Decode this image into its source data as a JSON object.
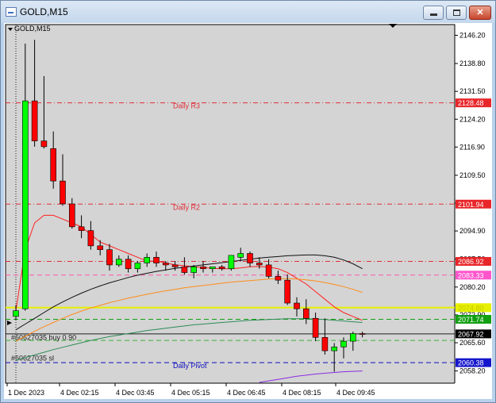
{
  "window": {
    "title": "GOLD,M15",
    "minimize_glyph": "minimize-icon",
    "maximize_glyph": "maximize-icon",
    "close_glyph": "✕"
  },
  "chart": {
    "symbol_label": "GOLD,M15",
    "colors": {
      "plot_bg": "#d4d4d4",
      "grid": "#b8b8b8",
      "bull": "#00ff00",
      "bear": "#ff0000",
      "wick": "#000000"
    }
  },
  "chart_data": {
    "type": "candlestick",
    "y_ticks": [
      "2146.20",
      "2138.80",
      "2131.50",
      "2124.20",
      "2116.90",
      "2109.50",
      "2102.20",
      "2094.90",
      "2087.50",
      "2080.20",
      "2072.90",
      "2065.60",
      "2058.20"
    ],
    "x_ticks": [
      "1 Dec 2023",
      "4 Dec 02:15",
      "4 Dec 03:45",
      "4 Dec 05:15",
      "4 Dec 06:45",
      "4 Dec 08:15",
      "4 Dec 09:45"
    ],
    "ylim": [
      2055.0,
      2149.0
    ],
    "candles": [
      [
        2072.5,
        2075.5,
        2071.5,
        2074.0
      ],
      [
        2074.5,
        2144.0,
        2074.0,
        2129.0
      ],
      [
        2129.0,
        2145.0,
        2117.0,
        2118.5
      ],
      [
        2118.5,
        2135.5,
        2116.5,
        2117.0
      ],
      [
        2116.5,
        2121.0,
        2106.0,
        2108.0
      ],
      [
        2108.0,
        2115.0,
        2101.5,
        2102.0
      ],
      [
        2102.0,
        2103.5,
        2095.5,
        2096.0
      ],
      [
        2096.0,
        2099.0,
        2093.0,
        2095.0
      ],
      [
        2095.0,
        2097.5,
        2090.0,
        2091.0
      ],
      [
        2091.0,
        2092.5,
        2088.5,
        2090.0
      ],
      [
        2090.0,
        2091.5,
        2084.5,
        2086.0
      ],
      [
        2086.0,
        2088.5,
        2085.5,
        2087.5
      ],
      [
        2087.5,
        2088.5,
        2084.0,
        2085.0
      ],
      [
        2085.0,
        2087.0,
        2084.0,
        2086.5
      ],
      [
        2086.5,
        2089.0,
        2085.5,
        2088.0
      ],
      [
        2088.0,
        2089.5,
        2085.5,
        2086.5
      ],
      [
        2086.5,
        2087.0,
        2084.5,
        2086.0
      ],
      [
        2086.0,
        2087.0,
        2084.5,
        2085.5
      ],
      [
        2085.5,
        2088.0,
        2083.5,
        2084.0
      ],
      [
        2084.0,
        2086.0,
        2082.5,
        2085.5
      ],
      [
        2085.5,
        2087.0,
        2084.0,
        2085.0
      ],
      [
        2085.0,
        2085.5,
        2084.0,
        2085.5
      ],
      [
        2085.5,
        2086.0,
        2084.5,
        2085.0
      ],
      [
        2085.0,
        2088.5,
        2084.5,
        2088.5
      ],
      [
        2088.0,
        2090.5,
        2087.0,
        2089.0
      ],
      [
        2089.0,
        2089.5,
        2085.5,
        2086.5
      ],
      [
        2086.5,
        2088.0,
        2085.0,
        2086.0
      ],
      [
        2086.0,
        2087.5,
        2082.5,
        2083.0
      ],
      [
        2083.0,
        2084.5,
        2081.0,
        2082.0
      ],
      [
        2082.0,
        2083.5,
        2075.5,
        2076.0
      ],
      [
        2076.0,
        2077.5,
        2072.5,
        2074.5
      ],
      [
        2074.5,
        2077.0,
        2070.5,
        2072.0
      ],
      [
        2072.0,
        2073.5,
        2066.0,
        2067.0
      ],
      [
        2067.0,
        2072.0,
        2062.5,
        2063.5
      ],
      [
        2063.5,
        2065.5,
        2058.0,
        2064.5
      ],
      [
        2064.5,
        2067.0,
        2061.5,
        2066.0
      ],
      [
        2066.0,
        2068.5,
        2063.5,
        2068.0
      ],
      [
        2068.0,
        2068.5,
        2067.0,
        2067.9
      ]
    ],
    "levels": [
      {
        "price": 2128.48,
        "label": "Daily R3",
        "price_text": "2128.48",
        "color": "#e0303a",
        "style": "dashdot",
        "box_bg": "#e8262a",
        "box_fg": "#ffffff"
      },
      {
        "price": 2101.94,
        "label": "Daily R2",
        "price_text": "2101.94",
        "color": "#e0303a",
        "style": "dashdot",
        "box_bg": "#e8262a",
        "box_fg": "#ffffff"
      },
      {
        "price": 2086.92,
        "label": "",
        "price_text": "2086.92",
        "color": "#e0303a",
        "style": "dashdot",
        "box_bg": "#e8262a",
        "box_fg": "#ffffff"
      },
      {
        "price": 2083.33,
        "label": "",
        "price_text": "2083.33",
        "color": "#ff55aa",
        "style": "dash",
        "box_bg": "#ff55cc",
        "box_fg": "#ffffff"
      },
      {
        "price": 2074.8,
        "label": "",
        "price_text": "2074.80",
        "color": "#e6f000",
        "style": "solid",
        "box_bg": "#e6f000",
        "box_fg": "#c8c800",
        "width": 2
      },
      {
        "price": 2071.74,
        "label": "",
        "price_text": "2071.74",
        "color": "#12a012",
        "style": "dash",
        "box_bg": "#12a012",
        "box_fg": "#ffffff"
      },
      {
        "price": 2067.92,
        "label": "",
        "price_text": "2067.92",
        "color": "#202020",
        "style": "solid",
        "box_bg": "#000000",
        "box_fg": "#ffffff"
      },
      {
        "price": 2066.2,
        "label": "",
        "price_text": "",
        "color": "#3cb43c",
        "style": "dash",
        "box_bg": "",
        "box_fg": ""
      },
      {
        "price": 2060.38,
        "label": "Daily Pivot",
        "price_text": "2060.38",
        "color": "#1010c0",
        "style": "dash",
        "box_bg": "#1515cc",
        "box_fg": "#ffffff"
      }
    ],
    "level_annotations": [
      {
        "text": "#60627035 buy 0.90",
        "price": 2067.0
      },
      {
        "text": "#60627035 sl",
        "price": 2061.5
      }
    ],
    "moving_averages": [
      {
        "color": "#ff2020",
        "values": [
          2074,
          2090,
          2097,
          2099,
          2099,
          2098,
          2097,
          2096,
          2094,
          2092,
          2091,
          2090,
          2089,
          2088,
          2087,
          2087,
          2086.5,
          2086,
          2085.8,
          2085.5,
          2085.3,
          2085.1,
          2085,
          2085,
          2085.2,
          2085.5,
          2085.6,
          2085.4,
          2085,
          2084,
          2082.5,
          2081,
          2079,
          2077,
          2075,
          2073.5,
          2072.5,
          2071.5
        ]
      },
      {
        "color": "#101010",
        "values": [
          2069,
          2070.5,
          2072,
          2073.5,
          2075,
          2076.3,
          2077.5,
          2078.6,
          2079.6,
          2080.5,
          2081.3,
          2082,
          2082.7,
          2083.3,
          2083.8,
          2084.3,
          2084.7,
          2085.1,
          2085.4,
          2085.7,
          2086,
          2086.3,
          2086.6,
          2086.9,
          2087.2,
          2087.5,
          2087.8,
          2088,
          2088.2,
          2088.4,
          2088.5,
          2088.6,
          2088.6,
          2088.4,
          2088.0,
          2087.3,
          2086.3,
          2085.0
        ]
      },
      {
        "color": "#ff8c1a",
        "values": [
          2066,
          2067.3,
          2068.6,
          2069.8,
          2070.9,
          2072,
          2073,
          2073.9,
          2074.7,
          2075.4,
          2076.1,
          2076.7,
          2077.3,
          2077.8,
          2078.3,
          2078.8,
          2079.2,
          2079.6,
          2080,
          2080.3,
          2080.6,
          2080.9,
          2081.2,
          2081.5,
          2081.7,
          2081.9,
          2082.1,
          2082.3,
          2082.4,
          2082.4,
          2082.3,
          2082.1,
          2081.8,
          2081.4,
          2080.9,
          2080.3,
          2079.6,
          2078.8
        ]
      },
      {
        "color": "#2e8b57",
        "values": [
          2061,
          2061.7,
          2062.4,
          2063.1,
          2063.8,
          2064.4,
          2065,
          2065.6,
          2066.2,
          2066.7,
          2067.2,
          2067.6,
          2068,
          2068.4,
          2068.8,
          2069.1,
          2069.4,
          2069.7,
          2070,
          2070.3,
          2070.5,
          2070.7,
          2070.9,
          2071.1,
          2071.3,
          2071.5,
          2071.6,
          2071.7,
          2071.8,
          2071.9,
          2071.9,
          2071.9,
          2071.8,
          2071.7,
          2071.5,
          2071.3,
          2071.1,
          2070.9
        ]
      },
      {
        "color": "#8a2be2",
        "values": [
          null,
          null,
          null,
          null,
          null,
          null,
          null,
          null,
          null,
          null,
          null,
          null,
          null,
          null,
          null,
          null,
          null,
          null,
          null,
          null,
          null,
          null,
          null,
          null,
          null,
          null,
          2055.2,
          2055.6,
          2056,
          2056.4,
          2056.8,
          2057.1,
          2057.4,
          2057.6,
          2057.8,
          2058,
          2058.1,
          2058.2
        ]
      }
    ]
  }
}
